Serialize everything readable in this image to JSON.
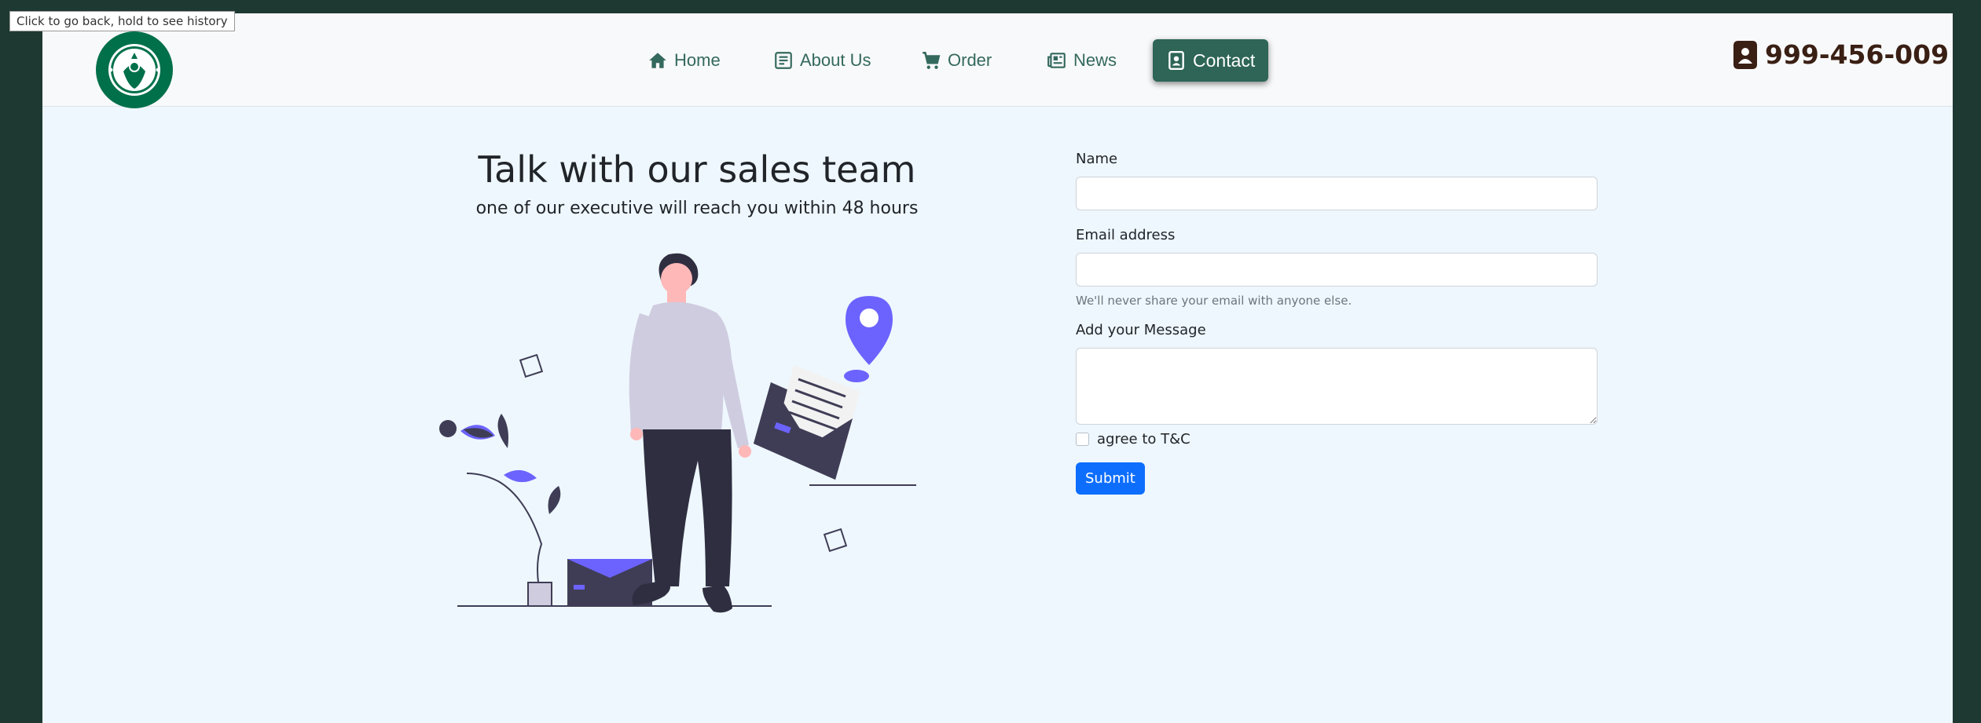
{
  "browser": {
    "back_tooltip": "Click to go back, hold to see history"
  },
  "header": {
    "logo_alt": "STARBUCKS COFFEE",
    "nav": [
      {
        "label": "Home",
        "icon": "home-icon",
        "active": false
      },
      {
        "label": "About Us",
        "icon": "newspaper-icon",
        "active": false
      },
      {
        "label": "Order",
        "icon": "cart-icon",
        "active": false
      },
      {
        "label": "News",
        "icon": "newspaper-icon",
        "active": false
      },
      {
        "label": "Contact",
        "icon": "contact-card-icon",
        "active": true
      }
    ],
    "phone": "999-456-009",
    "phone_icon": "contact-card-icon"
  },
  "hero": {
    "title": "Talk with our sales team",
    "subtitle": "one of our executive will reach you within 48 hours"
  },
  "form": {
    "name_label": "Name",
    "name_value": "",
    "email_label": "Email address",
    "email_value": "",
    "email_help": "We'll never share your email with anyone else.",
    "message_label": "Add your Message",
    "message_value": "",
    "checkbox_label": "agree to T&C",
    "checkbox_checked": false,
    "submit_label": "Submit"
  },
  "colors": {
    "frame": "#1e3932",
    "page_bg": "#eef7fd",
    "nav_text": "#34695e",
    "nav_active_bg": "#2e6556",
    "phone": "#3a1f14",
    "submit": "#0d6efd",
    "illustration_accent": "#6c63ff"
  }
}
